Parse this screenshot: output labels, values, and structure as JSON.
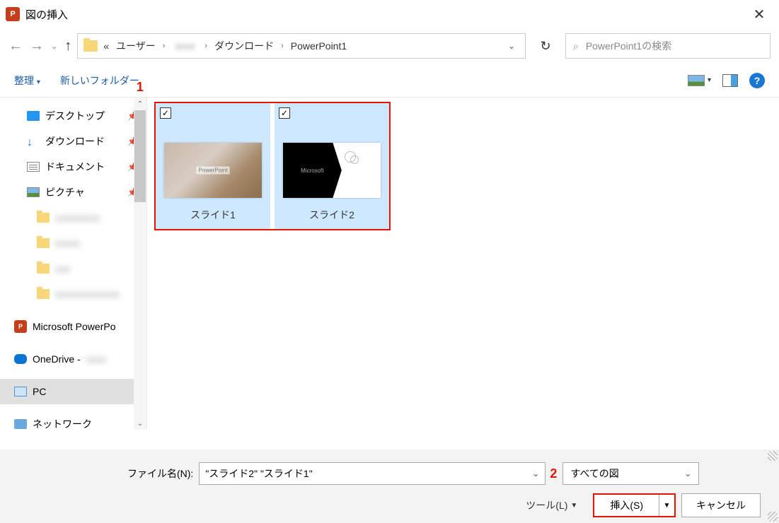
{
  "titlebar": {
    "title": "図の挿入"
  },
  "breadcrumb": {
    "prefix": "«",
    "items": [
      "ユーザー",
      "",
      "ダウンロード",
      "PowerPoint1"
    ]
  },
  "search": {
    "placeholder": "PowerPoint1の検索"
  },
  "toolbar": {
    "organize": "整理",
    "new_folder": "新しいフォルダー"
  },
  "annotations": {
    "a1": "1",
    "a2": "2"
  },
  "sidebar": {
    "items": [
      {
        "label": "デスクトップ",
        "pinned": true
      },
      {
        "label": "ダウンロード",
        "pinned": true
      },
      {
        "label": "ドキュメント",
        "pinned": true
      },
      {
        "label": "ピクチャ",
        "pinned": true
      },
      {
        "label": "",
        "blur": true
      },
      {
        "label": "",
        "blur": true
      },
      {
        "label": "",
        "blur": true
      },
      {
        "label": "",
        "blur": true
      },
      {
        "label": "Microsoft PowerPo"
      },
      {
        "label": "OneDrive -"
      },
      {
        "label": "PC",
        "selected": true
      },
      {
        "label": "ネットワーク"
      }
    ]
  },
  "files": [
    {
      "name": "スライド1"
    },
    {
      "name": "スライド2",
      "thumb_text": "Microsoft"
    }
  ],
  "bottom": {
    "filename_label": "ファイル名(N):",
    "filename_value": "\"スライド2\" \"スライド1\"",
    "filter": "すべての図",
    "tools": "ツール(L)",
    "insert": "挿入(S)",
    "cancel": "キャンセル"
  }
}
